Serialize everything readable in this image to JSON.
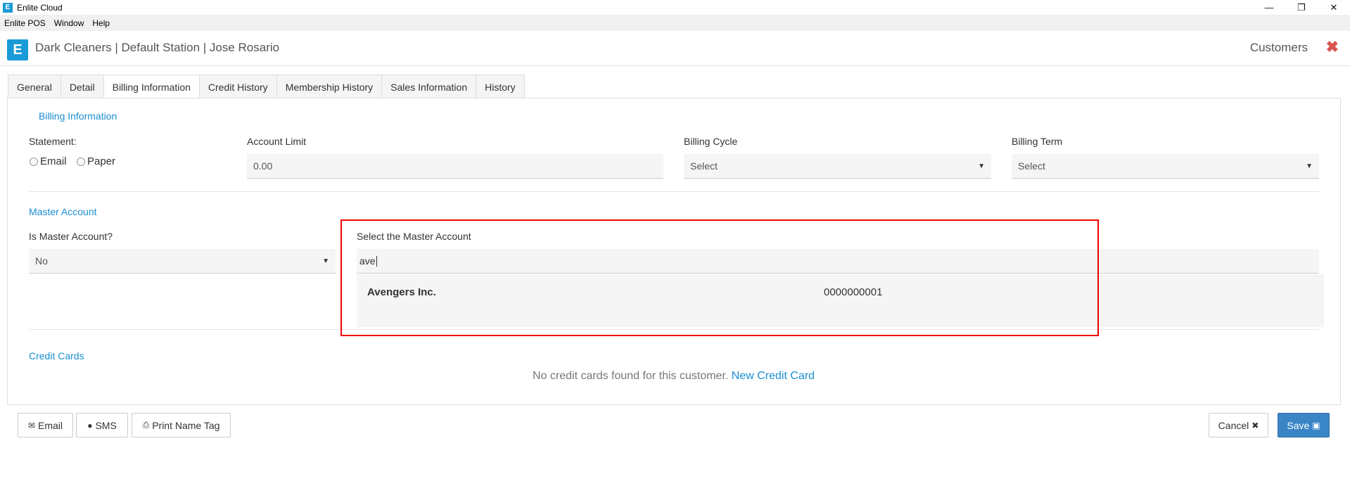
{
  "window": {
    "title": "Enlite Cloud",
    "app_icon_letter": "E",
    "controls": {
      "minimize": "—",
      "restore": "❐",
      "close": "✕"
    }
  },
  "menu": [
    "Enlite POS",
    "Window",
    "Help"
  ],
  "header": {
    "logo_letter": "E",
    "station": "Dark Cleaners | Default Station | Jose Rosario",
    "page_name": "Customers",
    "close_glyph": "✖"
  },
  "tabs": [
    "General",
    "Detail",
    "Billing Information",
    "Credit History",
    "Membership History",
    "Sales Information",
    "History"
  ],
  "active_tab": "Billing Information",
  "billing": {
    "section_title": "Billing Information",
    "statement_label": "Statement:",
    "statement_options": [
      "Email",
      "Paper"
    ],
    "account_limit_label": "Account Limit",
    "account_limit_value": "0.00",
    "billing_cycle_label": "Billing Cycle",
    "billing_cycle_value": "Select",
    "billing_term_label": "Billing Term",
    "billing_term_value": "Select"
  },
  "master": {
    "section_title": "Master Account",
    "is_master_label": "Is Master Account?",
    "is_master_value": "No",
    "select_master_label": "Select the Master Account",
    "search_value": "ave",
    "results": [
      {
        "name": "Avengers Inc.",
        "account": "0000000001"
      }
    ]
  },
  "credit_cards": {
    "section_title": "Credit Cards",
    "empty_text": "No credit cards found for this customer.",
    "new_link": "New Credit Card"
  },
  "footer": {
    "email_label": "Email",
    "sms_label": "SMS",
    "print_label": "Print Name Tag",
    "cancel_label": "Cancel",
    "save_label": "Save"
  },
  "colors": {
    "accent": "#1a8ed2",
    "brand": "#1a9ad6",
    "primary_button": "#3a85c6",
    "danger": "#d9534f",
    "highlight_box": "#e00000"
  }
}
